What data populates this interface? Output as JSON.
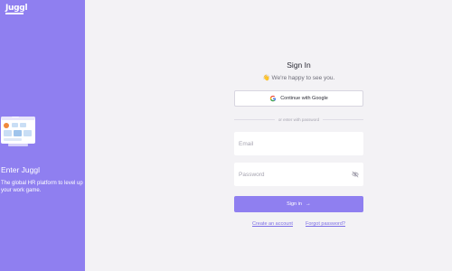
{
  "brand": {
    "logo_text": "Juggl"
  },
  "left_panel": {
    "title": "Enter Juggl",
    "tagline": "The global HR platform to level up your work game."
  },
  "signin": {
    "title": "Sign In",
    "welcome": "👋 We're happy to see you.",
    "google_label": "Continue with Google",
    "divider_text": "or enter with password",
    "email_placeholder": "Email",
    "password_placeholder": "Password",
    "submit_label": "Sign in",
    "create_account_label": "Create an account",
    "forgot_password_label": "Forgot password?"
  },
  "colors": {
    "accent": "#8f7ff0",
    "background": "#f3f2f5",
    "link": "#7d6fe6"
  },
  "icons": [
    "google-icon",
    "eye-off-icon",
    "arrow-right-icon",
    "dashboard-illustration"
  ]
}
